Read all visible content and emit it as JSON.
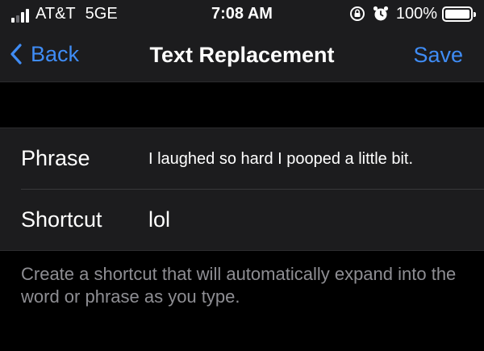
{
  "status_bar": {
    "carrier": "AT&T",
    "network": "5GE",
    "time": "7:08 AM",
    "battery_percent": "100%",
    "battery_level": 1.0,
    "icons": [
      "signal-bars-icon",
      "orientation-lock-icon",
      "alarm-icon",
      "battery-icon"
    ]
  },
  "nav": {
    "back_label": "Back",
    "title": "Text Replacement",
    "save_label": "Save"
  },
  "form": {
    "phrase_label": "Phrase",
    "phrase_value": "I laughed so hard I pooped a little bit.",
    "shortcut_label": "Shortcut",
    "shortcut_value": "lol"
  },
  "footer": {
    "text": "Create a shortcut that will automatically expand into the word or phrase as you type."
  },
  "colors": {
    "accent": "#3f8cf5",
    "background": "#000000",
    "surface": "#1c1c1e",
    "secondary_text": "#8e8e93"
  }
}
